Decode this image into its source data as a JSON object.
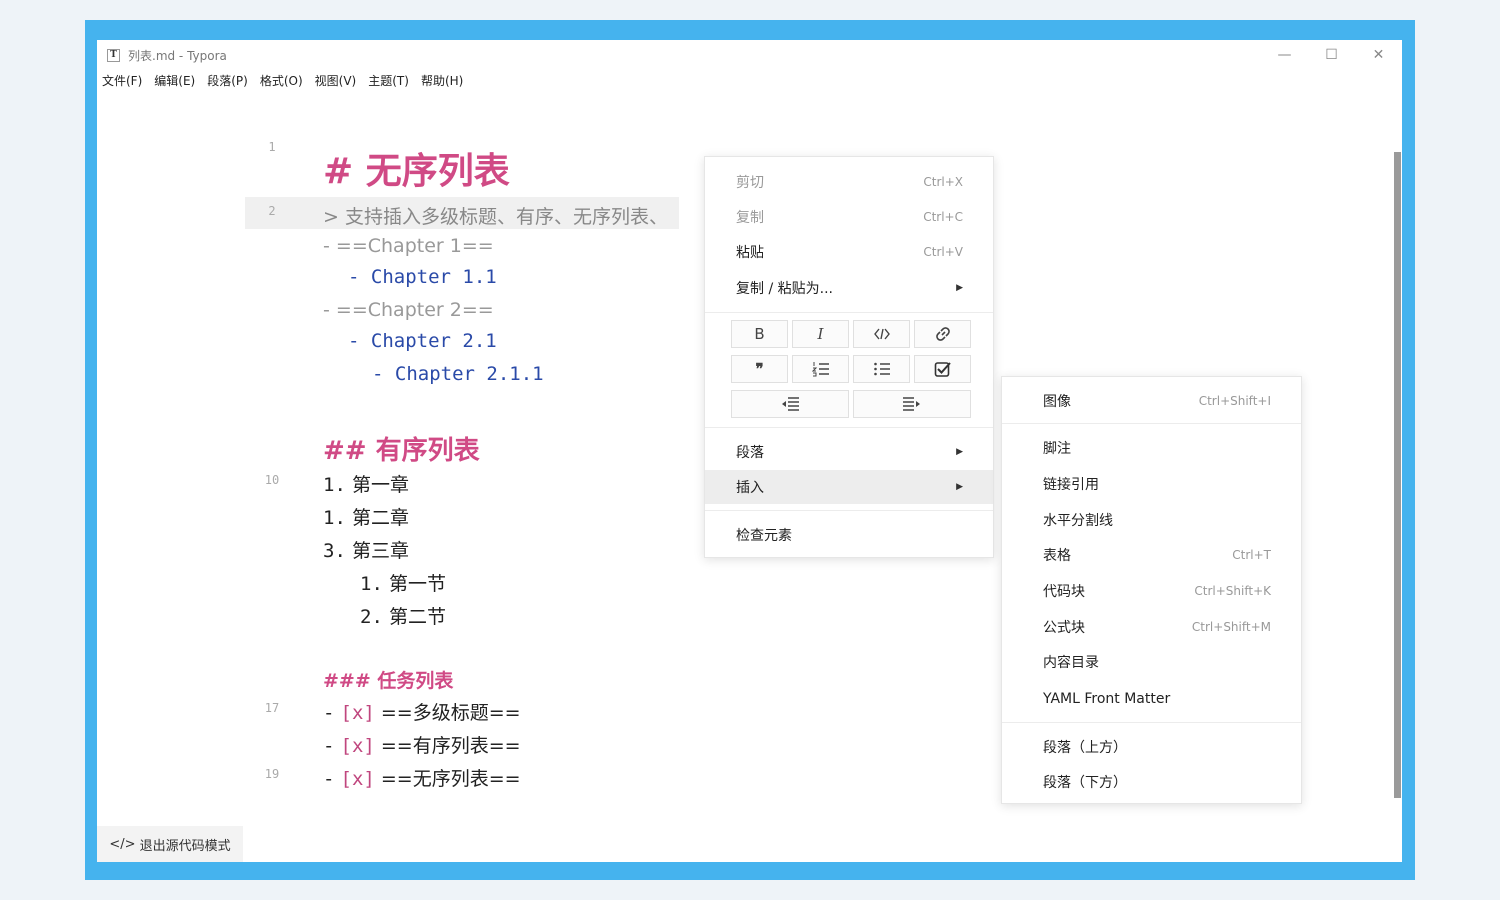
{
  "window": {
    "app_icon": "T",
    "title": "列表.md - Typora",
    "controls": {
      "minimize": "—",
      "maximize": "☐",
      "close": "✕"
    }
  },
  "menu": [
    "文件(F)",
    "编辑(E)",
    "段落(P)",
    "格式(O)",
    "视图(V)",
    "主题(T)",
    "帮助(H)"
  ],
  "editor": {
    "line_numbers": [
      "1",
      "2",
      "10",
      "17",
      "19"
    ],
    "h1": "# 无序列表",
    "quote": "> 支持插入多级标题、有序、无序列表、",
    "ul": [
      {
        "marker": "- ",
        "text": "==Chapter 1=="
      },
      {
        "marker": "- ",
        "text": "Chapter 1.1"
      },
      {
        "marker": "- ",
        "text": "==Chapter 2=="
      },
      {
        "marker": "- ",
        "text": "Chapter 2.1"
      },
      {
        "marker": "- ",
        "text": "Chapter 2.1.1"
      }
    ],
    "h2": "## 有序列表",
    "ol": [
      {
        "marker": "1.",
        "text": "第一章"
      },
      {
        "marker": "1.",
        "text": "第二章"
      },
      {
        "marker": "3.",
        "text": "第三章"
      },
      {
        "marker": "1.",
        "text": "第一节"
      },
      {
        "marker": "2.",
        "text": "第二节"
      }
    ],
    "h3": "### 任务列表",
    "tasks": [
      {
        "marker": "-",
        "check": "[x]",
        "text": "==多级标题=="
      },
      {
        "marker": "-",
        "check": "[x]",
        "text": "==有序列表=="
      },
      {
        "marker": "-",
        "check": "[x]",
        "text": "==无序列表=="
      }
    ]
  },
  "status": {
    "icon": "code-icon",
    "label": "退出源代码模式"
  },
  "context_menu": {
    "cut": {
      "label": "剪切",
      "shortcut": "Ctrl+X"
    },
    "copy": {
      "label": "复制",
      "shortcut": "Ctrl+C"
    },
    "paste": {
      "label": "粘贴",
      "shortcut": "Ctrl+V"
    },
    "copy_paste_as": {
      "label": "复制 / 粘贴为..."
    },
    "format_buttons": {
      "bold": "B",
      "italic": "I"
    },
    "paragraph": {
      "label": "段落"
    },
    "insert": {
      "label": "插入"
    },
    "inspect": {
      "label": "检查元素"
    }
  },
  "insert_submenu": [
    {
      "label": "图像",
      "shortcut": "Ctrl+Shift+I"
    },
    {
      "label": "脚注",
      "shortcut": ""
    },
    {
      "label": "链接引用",
      "shortcut": ""
    },
    {
      "label": "水平分割线",
      "shortcut": ""
    },
    {
      "label": "表格",
      "shortcut": "Ctrl+T"
    },
    {
      "label": "代码块",
      "shortcut": "Ctrl+Shift+K"
    },
    {
      "label": "公式块",
      "shortcut": "Ctrl+Shift+M"
    },
    {
      "label": "内容目录",
      "shortcut": ""
    },
    {
      "label": "YAML Front Matter",
      "shortcut": ""
    },
    {
      "label": "段落（上方）",
      "shortcut": ""
    },
    {
      "label": "段落（下方）",
      "shortcut": ""
    }
  ],
  "colors": {
    "frame": "#45b3ee",
    "heading": "#d04a85",
    "code": "#2a4aa8"
  }
}
